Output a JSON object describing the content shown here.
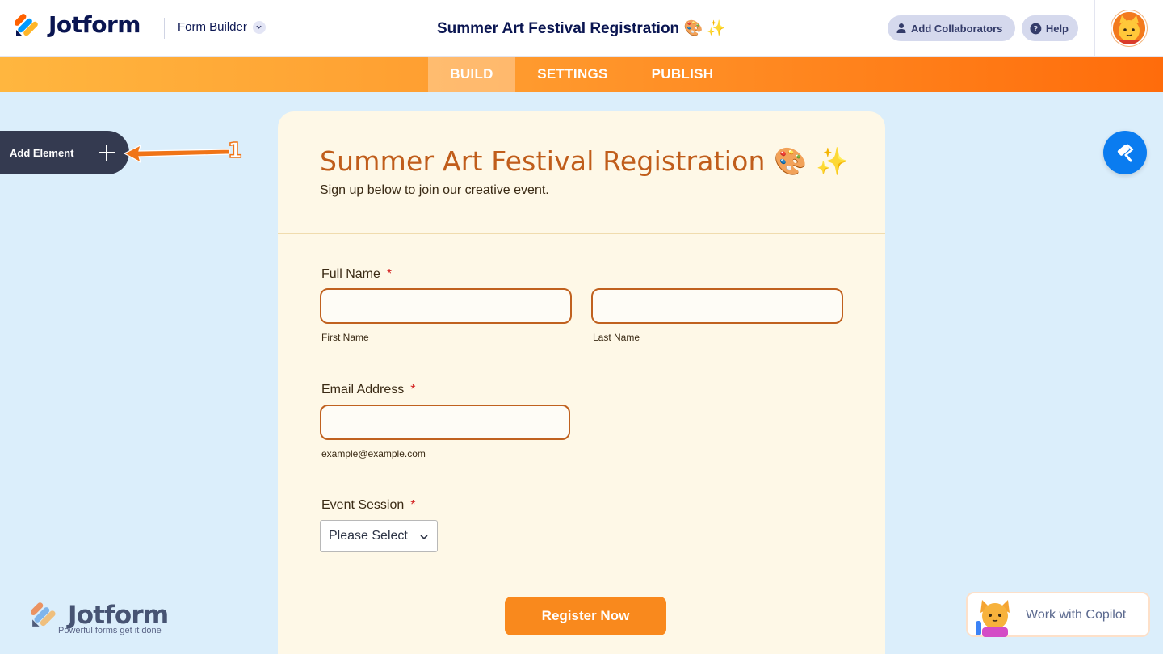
{
  "header": {
    "brand": "Jotform",
    "mode_label": "Form Builder",
    "form_title": "Summer Art Festival Registration 🎨 ✨",
    "add_collaborators": "Add Collaborators",
    "help": "Help"
  },
  "tabs": [
    {
      "label": "BUILD",
      "active": true
    },
    {
      "label": "SETTINGS",
      "active": false
    },
    {
      "label": "PUBLISH",
      "active": false
    }
  ],
  "sidebar": {
    "add_element": "Add Element",
    "annotation_number": "1"
  },
  "form": {
    "title": "Summer Art Festival Registration 🎨 ✨",
    "subtitle": "Sign up below to join our creative event.",
    "full_name": {
      "label": "Full Name",
      "required_mark": "*",
      "first_sublabel": "First Name",
      "last_sublabel": "Last Name",
      "first_value": "",
      "last_value": ""
    },
    "email": {
      "label": "Email Address",
      "required_mark": "*",
      "sublabel": "example@example.com",
      "value": ""
    },
    "event_session": {
      "label": "Event Session",
      "required_mark": "*",
      "selected": "Please Select"
    },
    "submit_label": "Register Now"
  },
  "footer": {
    "watermark_brand": "Jotform",
    "watermark_tagline": "Powerful forms get it done",
    "copilot_label": "Work with Copilot"
  },
  "colors": {
    "accent_orange": "#f9891d",
    "title_orange": "#c05d1b",
    "navy": "#0a1551",
    "roller_blue": "#0a7cf0",
    "canvas_bg": "#dbeefb",
    "form_bg": "#fef8e7"
  }
}
